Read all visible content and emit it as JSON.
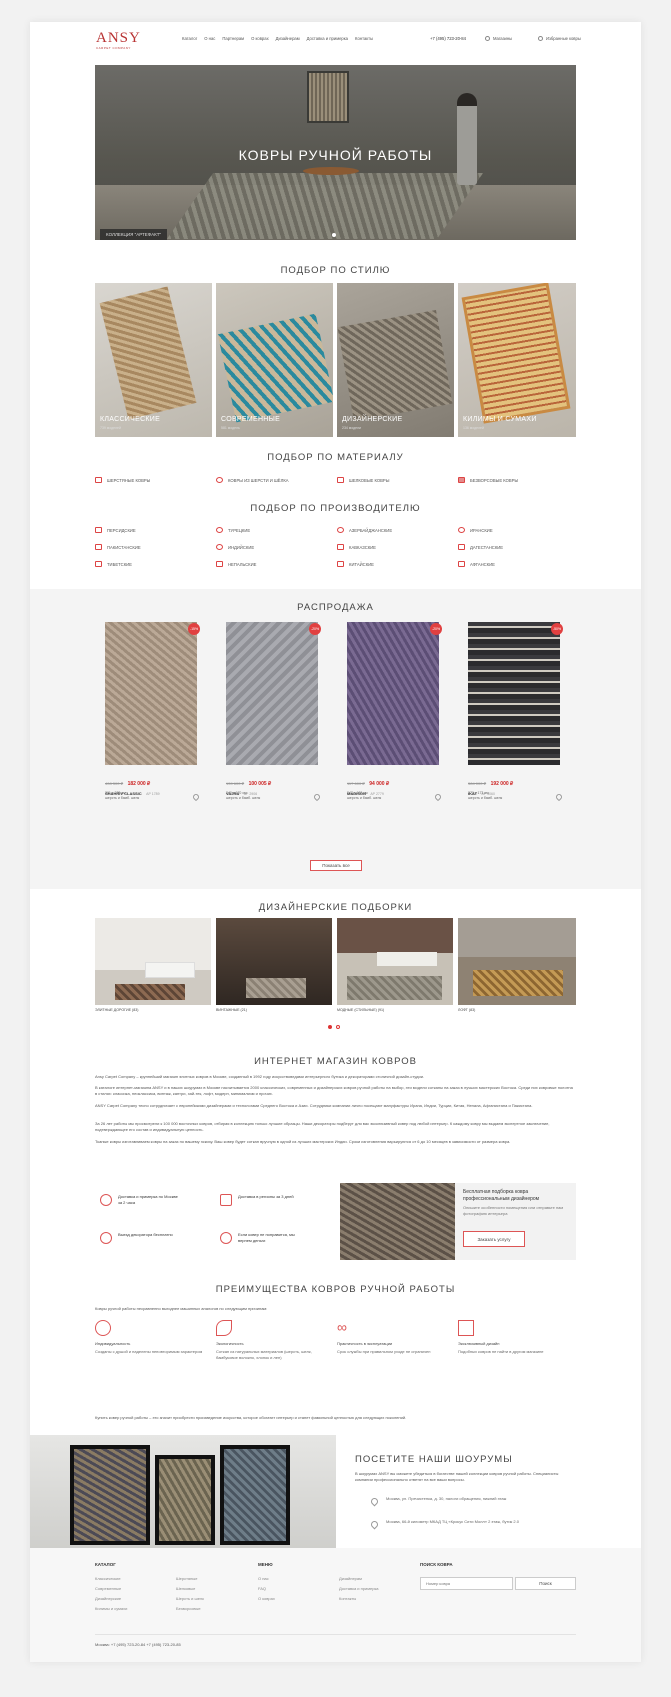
{
  "header": {
    "logo": "ANSY",
    "logo_sub": "CARPET COMPANY",
    "nav": [
      "Каталог",
      "О нас",
      "Партнерам",
      "О коврах",
      "Дизайнерам",
      "Доставка и примерка",
      "Контакты"
    ],
    "phone": "+7 (495) 723-20-84",
    "stores": "Магазины",
    "favorites": "Избранные ковры"
  },
  "hero": {
    "title": "КОВРЫ РУЧНОЙ РАБОТЫ",
    "badge": "КОЛЛЕКЦИЯ \"АРТЕФАКТ\""
  },
  "style_section": {
    "title": "ПОДБОР ПО СТИЛЮ",
    "cards": [
      {
        "label": "КЛАССИЧЕСКИЕ",
        "count": "739 моделей"
      },
      {
        "label": "СОВРЕМЕННЫЕ",
        "count": "581 модель"
      },
      {
        "label": "ДИЗАЙНЕРСКИЕ",
        "count": "234 модели"
      },
      {
        "label": "КИЛИМЫ И СУМАХИ",
        "count": "136 моделей"
      }
    ]
  },
  "material_section": {
    "title": "ПОДБОР ПО МАТЕРИАЛУ",
    "items": [
      "ШЕРСТЯНЫЕ КОВРЫ",
      "КОВРЫ ИЗ ШЕРСТИ И ШЁЛКА",
      "ШЕЛКОВЫЕ КОВРЫ",
      "БЕЗВОРСОВЫЕ КОВРЫ"
    ]
  },
  "maker_section": {
    "title": "ПОДБОР ПО ПРОИЗВОДИТЕЛЮ",
    "items": [
      "ПЕРСИДСКИЕ",
      "ТУРЕЦКИЕ",
      "АЗЕРБАЙДЖАНСКИЕ",
      "ИРАНСКИЕ",
      "ПАКИСТАНСКИЕ",
      "ИНДИЙСКИЕ",
      "КАВКАЗСКИЕ",
      "ДАГЕСТАНСКИЕ",
      "ТИБЕТСКИЕ",
      "НЕПАЛЬСКИЕ",
      "КИТАЙСКИЕ",
      "АФГАНСКИЕ"
    ]
  },
  "sale": {
    "title": "РАСПРОДАЖА",
    "show_all": "Показать все",
    "items": [
      {
        "badge": "-15%",
        "old": "408 300 ₽",
        "price": "182 000 ₽",
        "name": "SHAHRIV CLASSIC",
        "art": "АР 1789",
        "size": "201 x 228 см",
        "material": "шерсть и бамб. шелк"
      },
      {
        "badge": "-20%",
        "old": "139 600 ₽",
        "price": "100 005 ₽",
        "name": "VAJRA",
        "art": "АР 2906",
        "size": "240 x 170 см",
        "material": "шерсть и бамб. шелк"
      },
      {
        "badge": "-20%",
        "old": "117 600 ₽",
        "price": "94 000 ₽",
        "name": "MADISON",
        "art": "АР 2779",
        "size": "247 x 180 см",
        "material": "шерсть и бамб. шелк"
      },
      {
        "badge": "-50%",
        "old": "384 000 ₽",
        "price": "192 000 ₽",
        "name": "IKAT",
        "art": "АР 3060",
        "size": "270 x 173 см",
        "material": "шерсть и бамб. шелк"
      }
    ]
  },
  "designer": {
    "title": "ДИЗАЙНЕРСКИЕ ПОДБОРКИ",
    "items": [
      "ЭЛИТНЫЕ ДОРОГИЕ (83)",
      "ВИНТАЖНЫЕ (21)",
      "МОДНЫЕ (СТИЛЬНЫЕ) (91)",
      "ЛОФТ (83)"
    ]
  },
  "about": {
    "title": "ИНТЕРНЕТ МАГАЗИН КОВРОВ",
    "paragraphs": [
      "Ansy Carpet Company – крупнейший магазин элитных ковров в Москве, созданный в 1992 году искусствоведами интерьерного бутика и декораторами столичной дизайн-студии.",
      "В каталоге интернет-магазина ANSY и в наших шоурумах в Москве насчитывается 2000 классических, современных и дизайнерских ковров ручной работы на выбор, эти модели сотканы на заказ в лучших мастерских Востока. Среди них ковровые полотна в стилях: классика, неоклассика, винтаж, кантри, хай-тек, лофт, модерн, минимализм и прочих.",
      "ANSY Carpet Company тесно сотрудничает с европейскими дизайнерами и технологами Среднего Востока и Азии. Сотрудники компании лично посещают мануфактуры Ирана, Индии, Турции, Китая, Непала, Афганистана и Пакистана.",
      "За 26 лет работы мы просмотрели к 100 000 восточных ковров, отбирая в коллекцию только лучшие образцы. Наши декораторы подберут для вас эксклюзивный ковер под любой интерьер. К каждому ковру мы выдаем экспертное заключение, подтверждающее его состав и индивидуальную ценность.",
      "Тканые ковры изготавливаем ковры на заказ по вашему эскизу. Ваш ковер будет соткан вручную в одной из лучших мастерских Индии. Сроки изготовления варьируются от 6 до 10 месяцев в зависимости от размера ковра."
    ]
  },
  "services": {
    "items": [
      "Доставка и примерка по Москве за 2 часа",
      "Доставка в регионы за 3 дней",
      "Выезд декоратора бесплатно",
      "Если ковер не понравится, мы вернем деньги"
    ],
    "promo_title": "Бесплатная подборка ковра профессиональным дизайнером",
    "promo_text": "Опишите особенности помещения или отправьте нам фотографию интерьера",
    "promo_button": "Заказать услугу"
  },
  "advantages": {
    "title": "ПРЕИМУЩЕСТВА КОВРОВ РУЧНОЙ РАБОТЫ",
    "intro": "Ковры ручной работы несравненно выгоднее машинных аналогов по следующим причинам:",
    "items": [
      {
        "title": "Индивидуальность",
        "text": "Созданы с душой и наделены неповторимым характером"
      },
      {
        "title": "Экологичность",
        "text": "Соткан из натуральных материалов (шерсть, шелк, бамбуковое волокно, хлопок и лен)"
      },
      {
        "title": "Практичность в эксплуатации",
        "text": "Срок службы при правильном уходе не ограничен"
      },
      {
        "title": "Эксклюзивный дизайн",
        "text": "Подобных ковров не найти в другом магазине"
      }
    ],
    "outro": "Купить ковер ручной работы – это значит приобрести произведение искусства, которое обогатит интерьер и станет фамильной ценностью для следующих поколений."
  },
  "showroom": {
    "title": "ПОСЕТИТЕ НАШИ ШОУРУМЫ",
    "text": "В шоурумах ANSY вы сможете убедиться в богатстве нашей коллекции ковров ручной работы. Специалисты компании профессионально ответят на все ваши вопросы.",
    "addresses": [
      "Москва, ул. Пречистенка, д. 30, налоги обращения, нижний этаж",
      "Москва, 66-й километр МКАД ТЦ «Крокус Сити Молл» 2 этаж, бутик 2.0"
    ]
  },
  "footer": {
    "catalog_title": "КАТАЛОГ",
    "catalog_col1": [
      "Классические",
      "Современные",
      "Дизайнерские",
      "Килимы и сумахи"
    ],
    "catalog_col2": [
      "Шерстяные",
      "Шелковые",
      "Шерсть и шелк",
      "Безворсовые"
    ],
    "menu_title": "МЕНЮ",
    "menu_col1": [
      "О нас",
      "FAQ",
      "О коврах"
    ],
    "menu_col2": [
      "Дизайнерам",
      "Доставка и примерка",
      "Контакты"
    ],
    "search_title": "ПОИСК КОВРА",
    "search_placeholder": "Номер ковра",
    "search_button": "Поиск",
    "contacts": "Москва: +7 (495) 723-20-84  +7 (495) 723-20-85"
  },
  "colors": {
    "accent": "#d33333",
    "brand": "#b83232"
  }
}
